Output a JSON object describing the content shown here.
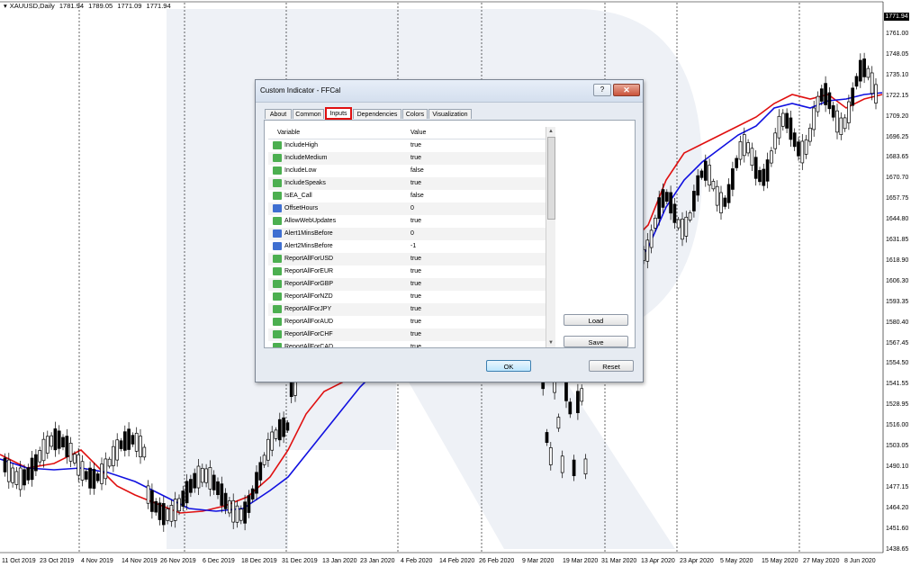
{
  "chart": {
    "symbol_label": "XAUUSD,Daily",
    "ohlc": [
      "1781.94",
      "1789.05",
      "1771.09",
      "1771.94"
    ],
    "current_price": "1771.94",
    "y_labels": [
      "1761.00",
      "1748.05",
      "1735.10",
      "1722.15",
      "1709.20",
      "1696.25",
      "1683.65",
      "1670.70",
      "1657.75",
      "1644.80",
      "1631.85",
      "1618.90",
      "1606.30",
      "1593.35",
      "1580.40",
      "1567.45",
      "1554.50",
      "1541.55",
      "1528.95",
      "1516.00",
      "1503.05",
      "1490.10",
      "1477.15",
      "1464.20",
      "1451.60",
      "1438.65"
    ],
    "x_labels": [
      "11 Oct 2019",
      "23 Oct 2019",
      "4 Nov 2019",
      "14 Nov 2019",
      "26 Nov 2019",
      "6 Dec 2019",
      "18 Dec 2019",
      "31 Dec 2019",
      "13 Jan 2020",
      "23 Jan 2020",
      "4 Feb 2020",
      "14 Feb 2020",
      "26 Feb 2020",
      "9 Mar 2020",
      "19 Mar 2020",
      "31 Mar 2020",
      "13 Apr 2020",
      "23 Apr 2020",
      "5 May 2020",
      "15 May 2020",
      "27 May 2020",
      "8 Jun 2020"
    ],
    "colors": {
      "ma_fast": "#e01010",
      "ma_slow": "#1010e0",
      "candle": "#000000",
      "grid": "#000000"
    }
  },
  "dialog": {
    "title": "Custom Indicator - FFCal",
    "help_label": "?",
    "close_label": "✕",
    "tabs": [
      "About",
      "Common",
      "Inputs",
      "Dependencies",
      "Colors",
      "Visualization"
    ],
    "active_tab": "Inputs",
    "columns": {
      "variable": "Variable",
      "value": "Value"
    },
    "rows": [
      {
        "name": "IncludeHigh",
        "value": "true",
        "icon": "bool-icon"
      },
      {
        "name": "IncludeMedium",
        "value": "true",
        "icon": "bool-icon"
      },
      {
        "name": "IncludeLow",
        "value": "false",
        "icon": "bool-icon"
      },
      {
        "name": "IncludeSpeaks",
        "value": "true",
        "icon": "bool-icon"
      },
      {
        "name": "IsEA_Call",
        "value": "false",
        "icon": "bool-icon"
      },
      {
        "name": "OffsetHours",
        "value": "0",
        "icon": "int-icon"
      },
      {
        "name": "AllowWebUpdates",
        "value": "true",
        "icon": "bool-icon"
      },
      {
        "name": "Alert1MinsBefore",
        "value": "0",
        "icon": "int-icon"
      },
      {
        "name": "Alert2MinsBefore",
        "value": "-1",
        "icon": "int-icon"
      },
      {
        "name": "ReportAllForUSD",
        "value": "true",
        "icon": "bool-icon"
      },
      {
        "name": "ReportAllForEUR",
        "value": "true",
        "icon": "bool-icon"
      },
      {
        "name": "ReportAllForGBP",
        "value": "true",
        "icon": "bool-icon"
      },
      {
        "name": "ReportAllForNZD",
        "value": "true",
        "icon": "bool-icon"
      },
      {
        "name": "ReportAllForJPY",
        "value": "true",
        "icon": "bool-icon"
      },
      {
        "name": "ReportAllForAUD",
        "value": "true",
        "icon": "bool-icon"
      },
      {
        "name": "ReportAllForCHF",
        "value": "true",
        "icon": "bool-icon"
      },
      {
        "name": "ReportAllForCAD",
        "value": "true",
        "icon": "bool-icon"
      }
    ],
    "buttons": {
      "load": "Load",
      "save": "Save",
      "ok": "OK",
      "reset": "Reset"
    }
  }
}
